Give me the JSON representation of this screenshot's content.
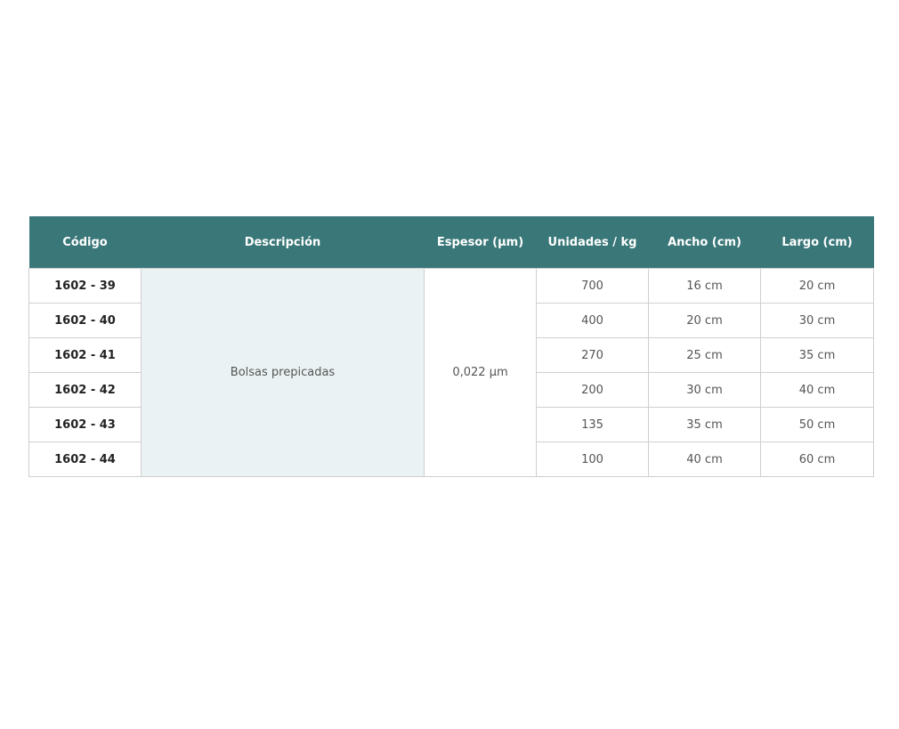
{
  "table": {
    "headers": [
      "Código",
      "Descripción",
      "Espesor (µm)",
      "Unidades / kg",
      "Ancho (cm)",
      "Largo (cm)"
    ],
    "description": "Bolsas prepicadas",
    "thickness": "0,022 µm",
    "rows": [
      {
        "code": "1602 - 39",
        "units": "700",
        "width": "16 cm",
        "length": "20 cm"
      },
      {
        "code": "1602 - 40",
        "units": "400",
        "width": "20 cm",
        "length": "30 cm"
      },
      {
        "code": "1602 - 41",
        "units": "270",
        "width": "25 cm",
        "length": "35 cm"
      },
      {
        "code": "1602 - 42",
        "units": "200",
        "width": "30 cm",
        "length": "40 cm"
      },
      {
        "code": "1602 - 43",
        "units": "135",
        "width": "35 cm",
        "length": "50 cm"
      },
      {
        "code": "1602 - 44",
        "units": "100",
        "width": "40 cm",
        "length": "60 cm"
      }
    ]
  }
}
